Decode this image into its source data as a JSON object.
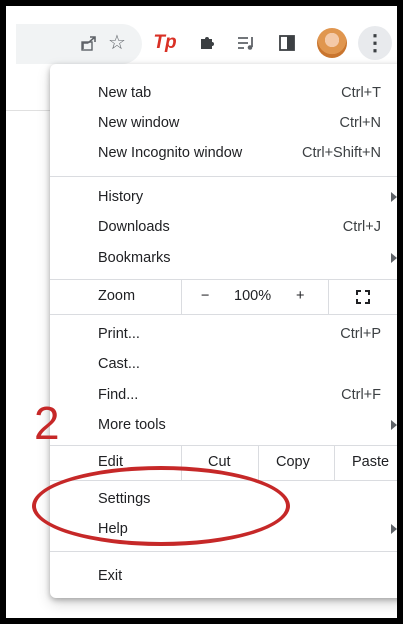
{
  "menu": {
    "items": {
      "new_tab": {
        "label": "New tab",
        "shortcut": "Ctrl+T"
      },
      "new_window": {
        "label": "New window",
        "shortcut": "Ctrl+N"
      },
      "new_incognito": {
        "label": "New Incognito window",
        "shortcut": "Ctrl+Shift+N"
      },
      "history": {
        "label": "History"
      },
      "downloads": {
        "label": "Downloads",
        "shortcut": "Ctrl+J"
      },
      "bookmarks": {
        "label": "Bookmarks"
      },
      "print": {
        "label": "Print...",
        "shortcut": "Ctrl+P"
      },
      "cast": {
        "label": "Cast..."
      },
      "find": {
        "label": "Find...",
        "shortcut": "Ctrl+F"
      },
      "more_tools": {
        "label": "More tools"
      },
      "settings": {
        "label": "Settings"
      },
      "help": {
        "label": "Help"
      },
      "exit": {
        "label": "Exit"
      }
    },
    "zoom": {
      "label": "Zoom",
      "minus": "−",
      "value": "100%",
      "plus": "+"
    },
    "edit": {
      "label": "Edit",
      "cut": "Cut",
      "copy": "Copy",
      "paste": "Paste"
    }
  },
  "toolbar": {
    "icons": [
      "share-icon",
      "star-icon",
      "tp-extension-icon",
      "puzzle-icon",
      "media-queue-icon",
      "side-panel-icon",
      "avatar",
      "menu-kebab-icon"
    ],
    "tp_label": "Tp"
  },
  "annotation": {
    "step_number": "2",
    "color": "#c62828"
  }
}
